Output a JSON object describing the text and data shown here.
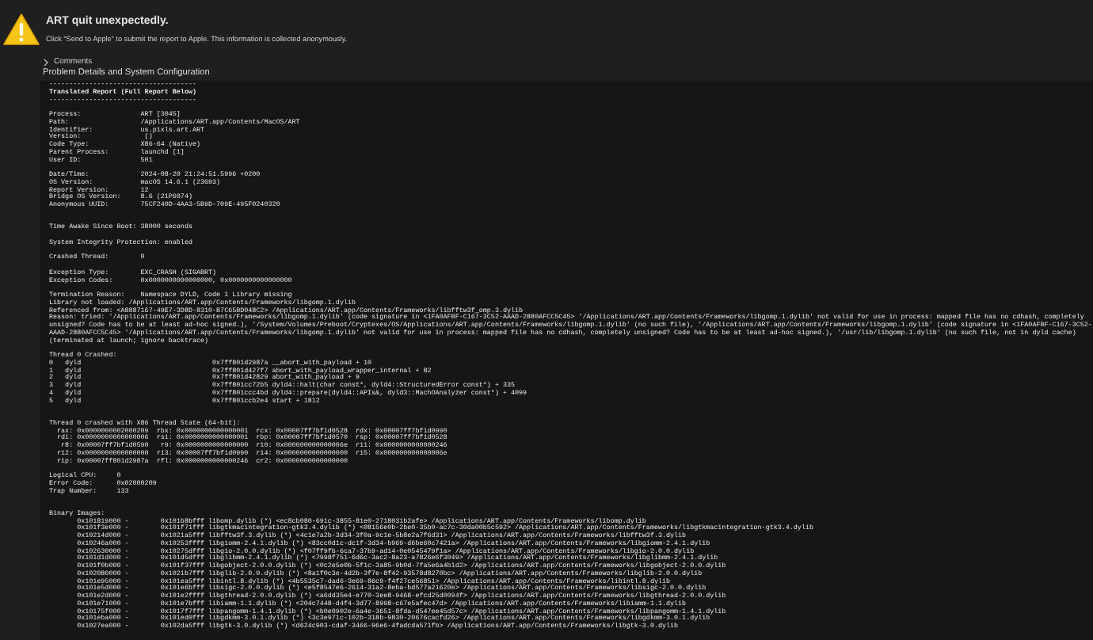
{
  "header": {
    "title": "ART quit unexpectedly.",
    "message": "Click “Send to Apple” to submit the report to Apple. This information is collected anonymously."
  },
  "comments": {
    "label": "Comments",
    "expanded": false
  },
  "section_title": "Problem Details and System Configuration",
  "report": {
    "rule": "-------------------------------------",
    "heading": "Translated Report (Full Report Below)",
    "blocks": [
      {
        "extra_space_before": false,
        "lines": [
          "Process:               ART [3045]",
          "Path:                  /Applications/ART.app/Contents/MacOS/ART",
          "Identifier:            us.pixls.art.ART",
          "Version:                ()",
          "Code Type:             X86-64 (Native)",
          "Parent Process:        launchd [1]",
          "User ID:               501"
        ]
      },
      {
        "extra_space_before": false,
        "lines": [
          "Date/Time:             2024-08-20 21:24:51.5996 +0200",
          "OS Version:            macOS 14.6.1 (23G93)",
          "Report Version:        12",
          "Bridge OS Version:     8.6 (21P6074)",
          "Anonymous UUID:        75CF240D-4AA3-5B9D-709E-495F0240320"
        ]
      },
      {
        "extra_space_before": true,
        "lines": [
          "Time Awake Since Boot: 38000 seconds"
        ]
      },
      {
        "extra_space_before": false,
        "lines": [
          "System Integrity Protection: enabled"
        ]
      },
      {
        "extra_space_before": false,
        "lines": [
          "Crashed Thread:        0"
        ]
      },
      {
        "extra_space_before": false,
        "lines": [
          "Exception Type:        EXC_CRASH (SIGABRT)",
          "Exception Codes:       0x0000000000000000, 0x0000000000000000"
        ]
      },
      {
        "extra_space_before": false,
        "lines": [
          "Termination Reason:    Namespace DYLD, Code 1 Library missing",
          "Library not loaded: /Applications/ART.app/Contents/Frameworks/libgomp.1.dylib",
          "Referenced from: <A8887167-49E7-3D8D-8310-B7C65BD048C2> /Applications/ART.app/Contents/Frameworks/libfftw3f_omp.3.dylib",
          "Reason: tried: '/Applications/ART.app/Contents/Frameworks/libgomp.1.dylib' (code signature in <1FA0AFBF-C167-3C52-AAAD-2880AFCC5C45> '/Applications/ART.app/Contents/Frameworks/libgomp.1.dylib' not valid for use in process: mapped file has no cdhash, completely",
          "unsigned? Code has to be at least ad-hoc signed.), '/System/Volumes/Preboot/Cryptexes/OS/Applications/ART.app/Contents/Frameworks/libgomp.1.dylib' (no such file), '/Applications/ART.app/Contents/Frameworks/libgomp.1.dylib' (code signature in <1FA0AFBF-C167-3C52-",
          "AAAD-2880AFCC5C45> '/Applications/ART.app/Contents/Frameworks/libgomp.1.dylib' not valid for use in process: mapped file has no cdhash, completely unsigned? Code has to be at least ad-hoc signed.), '/usr/lib/libgomp.1.dylib' (no such file, not in dyld cache)",
          "(terminated at launch; ignore backtrace)"
        ]
      },
      {
        "extra_space_before": false,
        "lines": [
          "Thread 0 Crashed:",
          "0   dyld                                 0x7ff801d2987a __abort_with_payload + 10",
          "1   dyld                                 0x7ff801d427f7 abort_with_payload_wrapper_internal + 82",
          "2   dyld                                 0x7ff801d42829 abort_with_payload + 9",
          "3   dyld                                 0x7ff801cc72b5 dyld4::halt(char const*, dyld4::StructuredError const*) + 335",
          "4   dyld                                 0x7ff801ccc4bd dyld4::prepare(dyld4::APIs&, dyld3::MachOAnalyzer const*) + 4099",
          "5   dyld                                 0x7ff801ccb2e4 start + 1812"
        ]
      },
      {
        "extra_space_before": true,
        "lines": [
          "Thread 0 crashed with X86 Thread State (64-bit):",
          "  rax: 0x0000000002000209  rbx: 0x0000000000000001  rcx: 0x00007ff7bf1d0528  rdx: 0x00007ff7bf1d0990",
          "  rdi: 0x0000000000000006  rsi: 0x0000000000000001  rbp: 0x00007ff7bf1d0570  rsp: 0x00007ff7bf1d0528",
          "   r8: 0x00007ff7bf1d0590   r9: 0x0000000000000000  r10: 0x000000000000006e  r11: 0x0000000000000246",
          "  r12: 0x0000000000000000  r13: 0x00007ff7bf1d0990  r14: 0x0000000000000000  r15: 0x000000000000006e",
          "  rip: 0x00007ff801d2987a  rfl: 0x0000000000000246  cr2: 0x0000000000000000"
        ]
      },
      {
        "extra_space_before": false,
        "lines": [
          "Logical CPU:     0",
          "Error Code:      0x02000209",
          "Trap Number:     133"
        ]
      },
      {
        "extra_space_before": true,
        "lines": [
          "Binary Images:",
          "       0x101819000 -        0x101b8bfff libomp.dylib (*) <ec8cb080-691c-3855-81e0-2718031b2afe> /Applications/ART.app/Contents/Frameworks/libomp.dylib",
          "       0x101f3e000 -        0x101f71fff libgtkmacintegration-gtk3.4.dylib (*) <08156e0b-2be0-35b0-ac7c-30da00b5c592> /Applications/ART.app/Contents/Frameworks/libgtkmacintegration-gtk3.4.dylib",
          "       0x10214d000 -        0x1021a5fff libfftw3f.3.dylib (*) <4c1e7a2b-3d34-3f0a-9c1e-5b8e2a7f6d31> /Applications/ART.app/Contents/Frameworks/libfftw3f.3.dylib",
          "       0x10246a000 -        0x10253ffff libgiomm-2.4.1.dylib (*) <83cc0d1c-dc1f-3d34-b969-d6be60c7421a> /Applications/ART.app/Contents/Frameworks/libgiomm-2.4.1.dylib",
          "       0x102630000 -        0x10275dfff libgio-2.0.0.dylib (*) <f07ff9fb-6ca7-37b9-ad14-0e0545479f1a> /Applications/ART.app/Contents/Frameworks/libgio-2.0.0.dylib",
          "       0x101d1d000 -        0x101d5dfff libglibmm-2.4.1.dylib (*) <7998f751-6d6c-3ac2-8a23-a7826e6f3049> /Applications/ART.app/Contents/Frameworks/libglibmm-2.4.1.dylib",
          "       0x101f0b000 -        0x101f37fff libgobject-2.0.0.dylib (*) <0c2e5e0b-5f1c-3a85-9b0d-7fa5e6a4b1d2> /Applications/ART.app/Contents/Frameworks/libgobject-2.0.0.dylib",
          "       0x102080000 -        0x1021b7fff libglib-2.0.0.dylib (*) <8a1f0c3e-4d2b-3f7e-8f42-93578d8270bc> /Applications/ART.app/Contents/Frameworks/libglib-2.0.0.dylib",
          "       0x101e95000 -        0x101ea5fff libintl.8.dylib (*) <4b5535c7-dad6-3e69-86c9-f4f27ce56851> /Applications/ART.app/Contents/Frameworks/libintl.8.dylib",
          "       0x101e5d000 -        0x101e6bfff libsigc-2.0.0.dylib (*) <e5f8547e6-2614-31a2-8eba-bd577a21620e> /Applications/ART.app/Contents/Frameworks/libsigc-2.0.0.dylib",
          "       0x101e2d000 -        0x101e2ffff libgthread-2.0.0.dylib (*) <a6dd35e4-e770-3ee8-9468-efcd25d0094f> /Applications/ART.app/Contents/Frameworks/libgthread-2.0.0.dylib",
          "       0x101e71000 -        0x101e7bfff libiamm-1.1.dylib (*) <204c7448-d4f4-3d77-8998-c67e5afec47d> /Applications/ART.app/Contents/Frameworks/libiamm-1.1.dylib",
          "       0x10175f000 -        0x1017f7fff libpangomm-1.4.1.dylib (*) <b0e0902e-6a4e-3651-8fda-d547ee45d57c> /Applications/ART.app/Contents/Frameworks/libpangomm-1.4.1.dylib",
          "       0x101eba000 -        0x101ed0fff libgdkmm-3.0.1.dylib (*) <3c3e971c-102b-318b-9830-20676cacfd26> /Applications/ART.app/Contents/Frameworks/libgdkmm-3.0.1.dylib",
          "       0x1027ea000 -        0x102da5fff libgtk-3.0.dylib (*) <d624c903-cdaf-3466-96e6-4fadcda571fb> /Applications/ART.app/Contents/Frameworks/libgtk-3.0.dylib"
        ]
      }
    ]
  }
}
